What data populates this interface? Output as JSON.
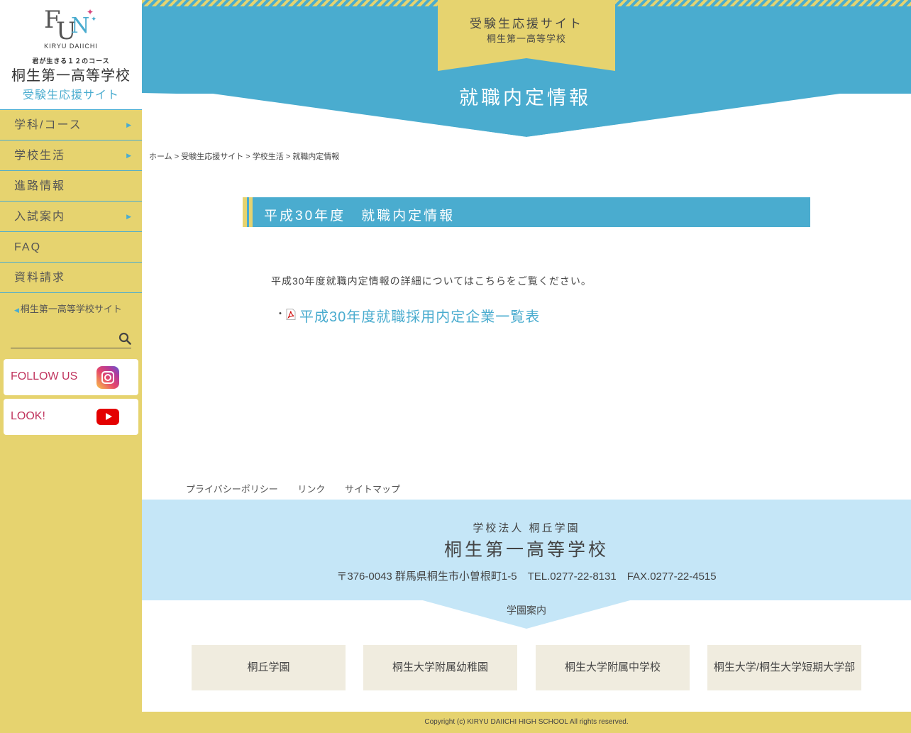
{
  "logo": {
    "brand_letters": [
      "F",
      "U",
      "N"
    ],
    "sub": "KIRYU DAIICHI",
    "tagline": "君が生きる１２のコース",
    "school_name": "桐生第一高等学校",
    "site_name": "受験生応援サイト"
  },
  "sidebar": {
    "nav": [
      {
        "label": "学科/コース",
        "has_submenu": true
      },
      {
        "label": "学校生活",
        "has_submenu": true
      },
      {
        "label": "進路情報",
        "has_submenu": false
      },
      {
        "label": "入試案内",
        "has_submenu": true
      },
      {
        "label": "FAQ",
        "has_submenu": false
      },
      {
        "label": "資料請求",
        "has_submenu": false
      }
    ],
    "back_link": "桐生第一高等学校サイト",
    "search_placeholder": "",
    "social": {
      "follow_label": "FOLLOW US",
      "look_label": "LOOK!"
    }
  },
  "header": {
    "site_title": "受験生応援サイト",
    "site_subtitle": "桐生第一高等学校",
    "page_title": "就職内定情報"
  },
  "breadcrumb": [
    "ホーム",
    "受験生応援サイト",
    "学校生活",
    "就職内定情報"
  ],
  "main": {
    "section_title": "平成30年度　就職内定情報",
    "intro": "平成30年度就職内定情報の詳細についてはこちらをご覧ください。",
    "bullet": "・",
    "pdf_link": "平成30年度就職採用内定企業一覧表"
  },
  "footer": {
    "links": [
      "プライバシーポリシー",
      "リンク",
      "サイトマップ"
    ],
    "corp": "学校法人 桐丘学園",
    "school": "桐生第一高等学校",
    "address": "〒376-0043 群馬県桐生市小曽根町1-5　TEL.0277-22-8131　FAX.0277-22-4515",
    "gakuen_label": "学園案内",
    "group": [
      "桐丘学園",
      "桐生大学附属幼稚園",
      "桐生大学附属中学校",
      "桐生大学/桐生大学短期大学部"
    ],
    "copyright": "Copyright (c) KIRYU DAIICHI HIGH SCHOOL All rights reserved."
  },
  "colors": {
    "primary_blue": "#4aaccf",
    "accent_yellow": "#e6d36f",
    "light_blue": "#c5e6f7",
    "link_red": "#c0345e"
  }
}
